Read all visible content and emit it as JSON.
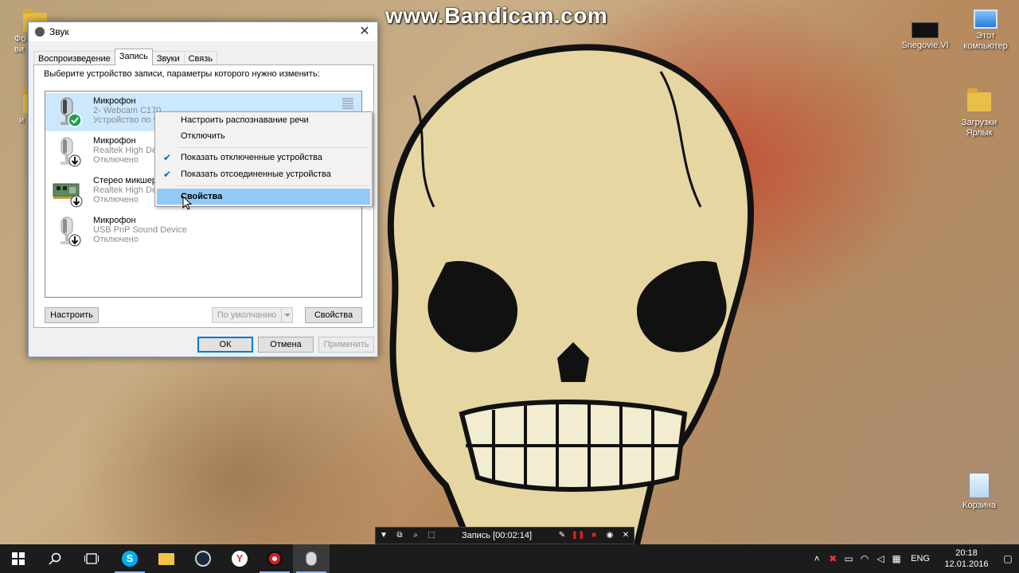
{
  "watermark": "www.Bandicam.com",
  "desktop": {
    "icons_left": [
      {
        "label": "Фо\nви"
      },
      {
        "label": "и"
      }
    ],
    "icons_right": [
      {
        "label": "Snegovie.VI"
      },
      {
        "label": "Этот компьютер"
      },
      {
        "label": "Загрузки Ярлык"
      },
      {
        "label": "Корзина"
      }
    ]
  },
  "dialog": {
    "title": "Звук",
    "close_glyph": "✕",
    "tabs": [
      {
        "label": "Воспроизведение",
        "active": false
      },
      {
        "label": "Запись",
        "active": true
      },
      {
        "label": "Звуки",
        "active": false
      },
      {
        "label": "Связь",
        "active": false
      }
    ],
    "description": "Выберите устройство записи, параметры которого нужно изменить:",
    "devices": [
      {
        "name": "Микрофон",
        "line2": "2- Webcam C170",
        "line3": "Устройство по у",
        "status_icon": "check-icon",
        "selected": true
      },
      {
        "name": "Микрофон",
        "line2": "Realtek High De",
        "line3": "Отключено",
        "status_icon": "down-arrow-icon",
        "selected": false
      },
      {
        "name": "Стерео микшер",
        "line2": "Realtek High De",
        "line3": "Отключено",
        "status_icon": "down-arrow-icon",
        "selected": false
      },
      {
        "name": "Микрофон",
        "line2": "USB PnP Sound Device",
        "line3": "Отключено",
        "status_icon": "down-arrow-icon",
        "selected": false
      }
    ],
    "buttons": {
      "configure": "Настроить",
      "set_default": "По умолчанию",
      "properties": "Свойства",
      "ok": "ОК",
      "cancel": "Отмена",
      "apply": "Применить"
    }
  },
  "context_menu": {
    "items": [
      {
        "label": "Настроить распознавание речи",
        "checked": false
      },
      {
        "label": "Отключить",
        "checked": false
      },
      {
        "label": "Показать отключенные устройства",
        "checked": true
      },
      {
        "label": "Показать отсоединенные устройства",
        "checked": true
      },
      {
        "label": "Свойства",
        "checked": false,
        "hover": true
      }
    ]
  },
  "recorder": {
    "status": "Запись [00:02:14]"
  },
  "taskbar": {
    "apps": [
      "windows-start-icon",
      "search-icon",
      "task-view-icon",
      "skype-icon",
      "file-explorer-icon",
      "steam-icon",
      "yandex-browser-icon",
      "bandicam-icon",
      "sound-settings-icon"
    ],
    "language": "ENG",
    "time": "20:18",
    "date": "12.01.2016"
  },
  "colors": {
    "selection": "#cce8ff",
    "menu_hover": "#91c9f7",
    "accent": "#0078d7",
    "taskbar": "#1c1c1c"
  }
}
